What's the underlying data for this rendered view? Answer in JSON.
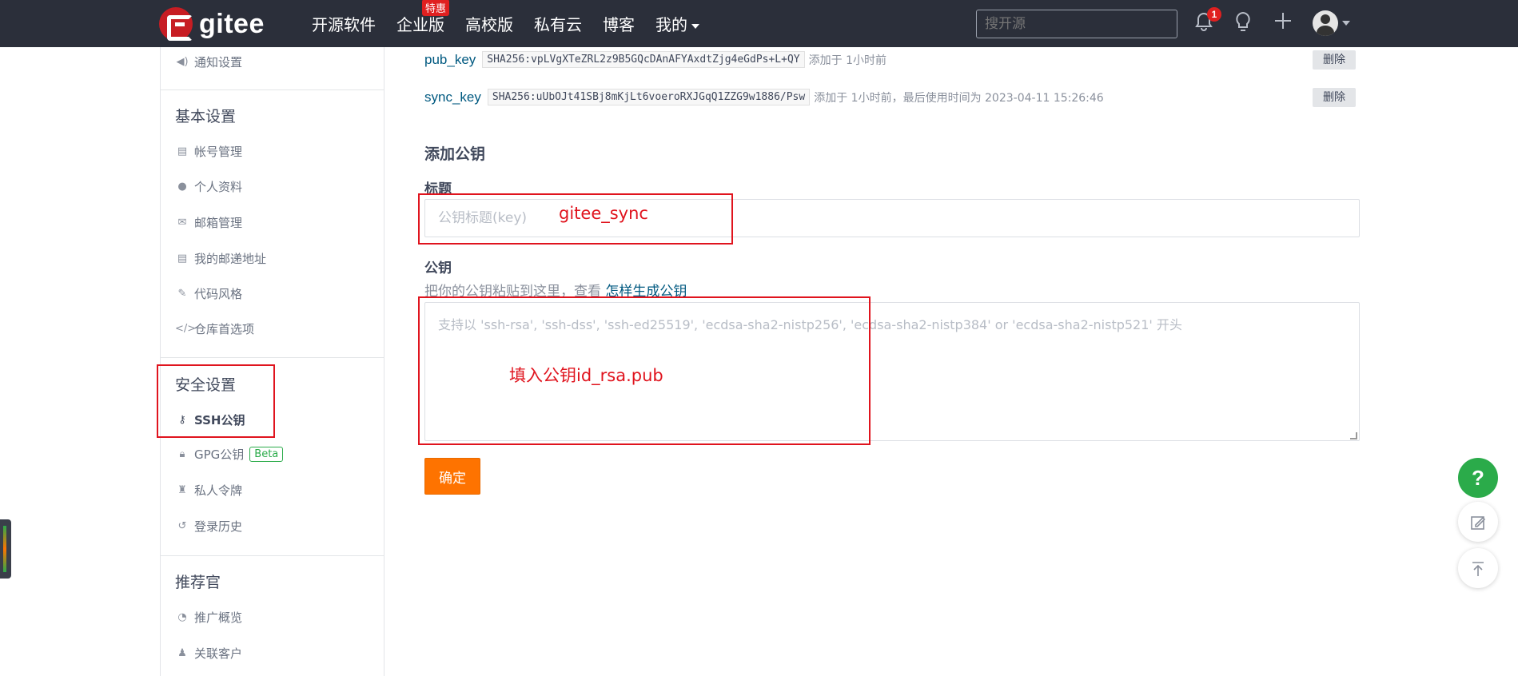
{
  "header": {
    "logo_text": "gitee",
    "nav": [
      "开源软件",
      "企业版",
      "高校版",
      "私有云",
      "博客",
      "我的"
    ],
    "hot_badge": "特惠",
    "search_placeholder": "搜开源",
    "notification_count": "1"
  },
  "sidebar": {
    "notify_item": "通知设置",
    "basic_section": "基本设置",
    "basic_items": [
      "帐号管理",
      "个人资料",
      "邮箱管理",
      "我的邮递地址",
      "代码风格",
      "仓库首选项"
    ],
    "security_section": "安全设置",
    "ssh_item": "SSH公钥",
    "gpg_item": "GPG公钥",
    "gpg_badge": "Beta",
    "token_item": "私人令牌",
    "history_item": "登录历史",
    "promo_section": "推荐官",
    "promo_items": [
      "推广概览",
      "关联客户"
    ]
  },
  "keys": [
    {
      "name": "pub_key",
      "fingerprint": "SHA256:vpLVgXTeZRL2z9B5GQcDAnAFYAxdtZjg4eGdPs+L+QY",
      "meta": "添加于 1小时前",
      "delete_label": "删除"
    },
    {
      "name": "sync_key",
      "fingerprint": "SHA256:uUbOJt41SBj8mKjLt6voeroRXJGqQ1ZZG9w1886/Psw",
      "meta": "添加于 1小时前，最后使用时间为 2023-04-11 15:26:46",
      "delete_label": "删除"
    }
  ],
  "form": {
    "heading": "添加公钥",
    "title_label": "标题",
    "title_placeholder": "公钥标题(key)",
    "key_label": "公钥",
    "hint_text": "把你的公钥粘贴到这里，查看 ",
    "hint_link": "怎样生成公钥",
    "key_placeholder": "支持以 'ssh-rsa', 'ssh-dss', 'ssh-ed25519', 'ecdsa-sha2-nistp256', 'ecdsa-sha2-nistp384' or 'ecdsa-sha2-nistp521' 开头",
    "submit_label": "确定"
  },
  "annotations": {
    "title_note": "gitee_sync",
    "key_note": "填入公钥id_rsa.pub"
  },
  "floating": {
    "help_label": "?"
  },
  "colors": {
    "header_bg": "#2b2f3a",
    "brand_red": "#c71d23",
    "submit_orange": "#fe7300",
    "annotation_red": "#e0141e",
    "help_green": "#2bab4a",
    "link_blue": "#005980"
  }
}
